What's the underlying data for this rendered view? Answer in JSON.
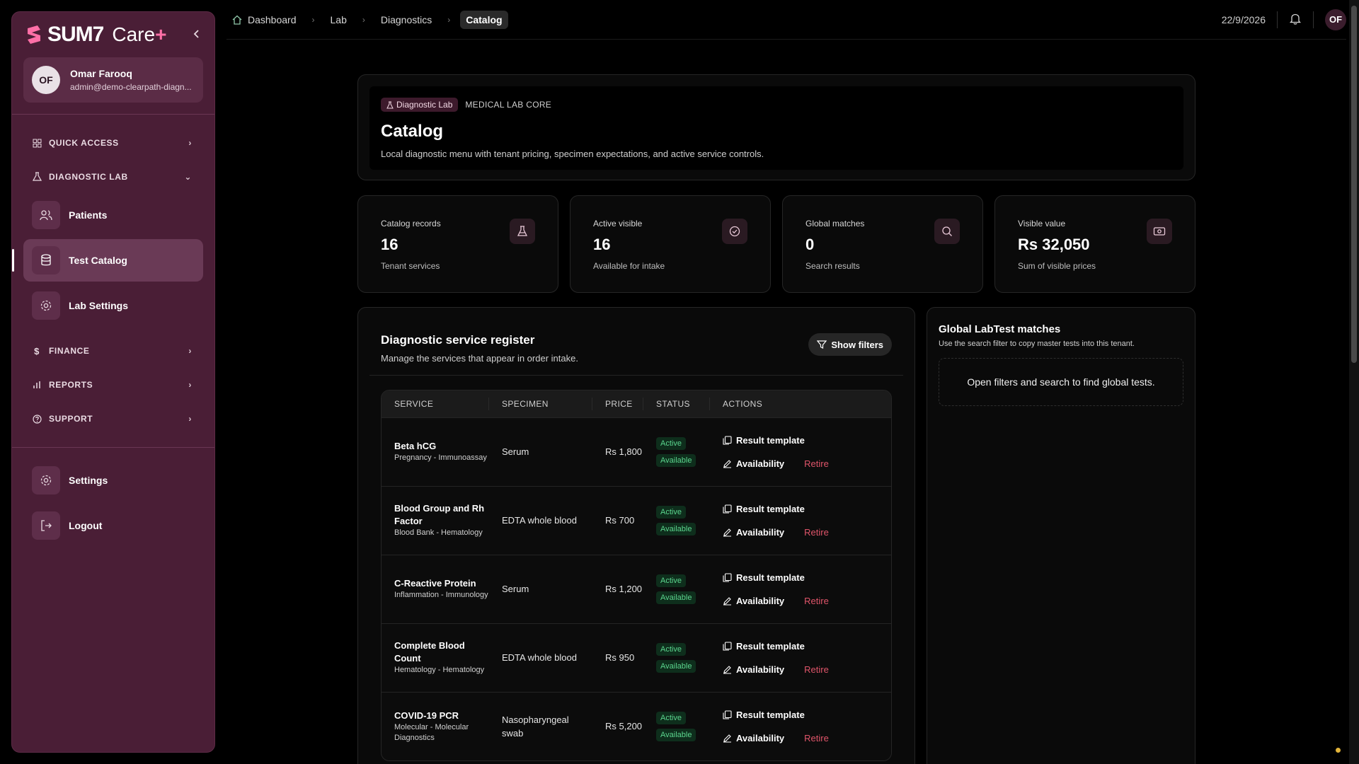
{
  "brand": {
    "name": "SUM7",
    "care": "Care",
    "plus": "+"
  },
  "user": {
    "initials": "OF",
    "name": "Omar Farooq",
    "email": "admin@demo-clearpath-diagn..."
  },
  "sidebar": {
    "quick_access": "QUICK ACCESS",
    "diagnostic_lab": "DIAGNOSTIC LAB",
    "items": [
      {
        "label": "Patients"
      },
      {
        "label": "Test Catalog"
      },
      {
        "label": "Lab Settings"
      }
    ],
    "finance": "FINANCE",
    "reports": "REPORTS",
    "support": "SUPPORT",
    "settings": "Settings",
    "logout": "Logout"
  },
  "breadcrumb": [
    "Dashboard",
    "Lab",
    "Diagnostics",
    "Catalog"
  ],
  "topbar": {
    "date": "22/9/2026",
    "initials": "OF"
  },
  "hero": {
    "badge_lab": "Diagnostic Lab",
    "badge_core": "MEDICAL LAB CORE",
    "title": "Catalog",
    "subtitle": "Local diagnostic menu with tenant pricing, specimen expectations, and active service controls."
  },
  "stats": [
    {
      "label": "Catalog records",
      "value": "16",
      "sub": "Tenant services"
    },
    {
      "label": "Active visible",
      "value": "16",
      "sub": "Available for intake"
    },
    {
      "label": "Global matches",
      "value": "0",
      "sub": "Search results"
    },
    {
      "label": "Visible value",
      "value": "Rs 32,050",
      "sub": "Sum of visible prices"
    }
  ],
  "register": {
    "title": "Diagnostic service register",
    "subtitle": "Manage the services that appear in order intake.",
    "filters_button": "Show filters",
    "columns": [
      "SERVICE",
      "SPECIMEN",
      "PRICE",
      "STATUS",
      "ACTIONS"
    ],
    "rows": [
      {
        "name": "Beta hCG",
        "category": "Pregnancy - Immunoassay",
        "specimen": "Serum",
        "price": "Rs 1,800",
        "status1": "Active",
        "status2": "Available"
      },
      {
        "name": "Blood Group and Rh Factor",
        "category": "Blood Bank - Hematology",
        "specimen": "EDTA whole blood",
        "price": "Rs 700",
        "status1": "Active",
        "status2": "Available"
      },
      {
        "name": "C-Reactive Protein",
        "category": "Inflammation - Immunology",
        "specimen": "Serum",
        "price": "Rs 1,200",
        "status1": "Active",
        "status2": "Available"
      },
      {
        "name": "Complete Blood Count",
        "category": "Hematology - Hematology",
        "specimen": "EDTA whole blood",
        "price": "Rs 950",
        "status1": "Active",
        "status2": "Available"
      },
      {
        "name": "COVID-19 PCR",
        "category": "Molecular - Molecular Diagnostics",
        "specimen": "Nasopharyngeal swab",
        "price": "Rs 5,200",
        "status1": "Active",
        "status2": "Available"
      }
    ],
    "actions": {
      "template": "Result template",
      "availability": "Availability",
      "retire": "Retire"
    }
  },
  "global": {
    "title": "Global LabTest matches",
    "desc": "Use the search filter to copy master tests into this tenant.",
    "empty": "Open filters and search to find global tests."
  },
  "colors": {
    "sidebar": "#4a1e36",
    "accent": "#ff6fa7",
    "active_green": "#5bd68e",
    "retire_red": "#e0556a"
  }
}
